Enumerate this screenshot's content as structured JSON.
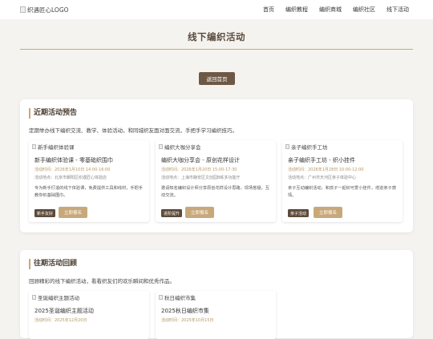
{
  "header": {
    "logo_alt": "织遇匠心LOGO",
    "nav": [
      "首页",
      "编织教程",
      "编织商城",
      "编织社区",
      "线下活动"
    ]
  },
  "page": {
    "title": "线下编织活动",
    "back_label": "返回首页"
  },
  "upcoming": {
    "heading": "近期活动预告",
    "description": "定期举办线下编织交流、教学、体验活动，和同城织友面对面交流，手把手学习编织技巧。",
    "cards": [
      {
        "image_alt": "新手编织体验课",
        "title": "新手编织体验课 - 零基础织围巾",
        "time": "活动时间：2026年1月10日 14:00-16:00",
        "place": "活动地点：北京市朝阳区织遇匠心体验店",
        "text": "专为新手打造的线下体验课，免费提供工具和线材，手把手教你织基础围巾。",
        "tag": "新手友好",
        "button": "立即报名"
      },
      {
        "image_alt": "编织大咖分享会",
        "title": "编织大咖分享会 - 原创花样设计",
        "time": "活动时间：2026年1月20日 15:00-17:30",
        "place": "活动地点：上海市静安区文创园B栋多功能厅",
        "text": "邀请知名编织设计师分享原创花样设计思路，现场答疑，互动交流。",
        "tag": "进阶提升",
        "button": "立即报名"
      },
      {
        "image_alt": "亲子编织手工坊",
        "title": "亲子编织手工坊 - 织小挂件",
        "time": "活动时间：2026年1月28日 10:00-12:00",
        "place": "活动地点：广州市天河区亲子体验中心",
        "text": "亲子互动编织活动，和孩子一起织可爱小挂件，增进亲子感情。",
        "tag": "亲子活动",
        "button": "立即报名"
      }
    ]
  },
  "past": {
    "heading": "往期活动回顾",
    "description": "回顾精彩的线下编织活动，看看织友们的欢乐瞬间和优秀作品。",
    "cards": [
      {
        "image_alt": "圣诞编织主题活动",
        "title": "2025圣诞编织主题活动",
        "time": "活动时间：2025年12月20日"
      },
      {
        "image_alt": "秋日编织市集",
        "title": "2025秋日编织市集",
        "time": "活动时间：2025年10月15日"
      }
    ]
  }
}
